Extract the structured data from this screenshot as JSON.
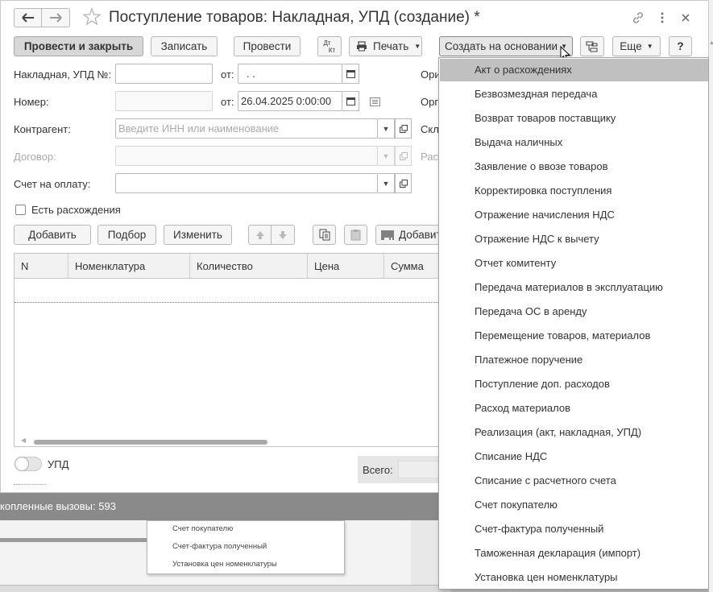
{
  "window": {
    "title": "Поступление товаров: Накладная, УПД (создание) *"
  },
  "toolbar": {
    "post_close": "Провести и закрыть",
    "save": "Записать",
    "post": "Провести",
    "dtkt_top": "Дт",
    "dtkt_bottom": "Кт",
    "print": "Печать",
    "create_based": "Создать на основании",
    "more": "Еще",
    "help": "?"
  },
  "form": {
    "invoice_label": "Накладная, УПД №:",
    "invoice_value": "",
    "from1_label": "от:",
    "date1_value": " .  .",
    "number_label": "Номер:",
    "from2_label": "от:",
    "date2_value": "26.04.2025  0:00:00",
    "counterparty_label": "Контрагент:",
    "counterparty_placeholder": "Введите ИНН или наименование",
    "contract_label": "Договор:",
    "payment_label": "Счет на оплату:",
    "discrepancy_label": "Есть расхождения",
    "right_labels": [
      "Ори",
      "Орг",
      "Скл",
      "Рас"
    ]
  },
  "table_toolbar": {
    "add": "Добавить",
    "pick": "Подбор",
    "change": "Изменить",
    "add_barcode": "Добавит"
  },
  "table": {
    "columns": [
      "N",
      "Номенклатура",
      "Количество",
      "Цена",
      "Сумма"
    ]
  },
  "footer": {
    "upd_label": "УПД",
    "total_label": "Всего:"
  },
  "background": {
    "status_text": "копленные вызовы: 593",
    "list_items": [
      "Счет покупателю",
      "Счет-фактура полученный",
      "Установка цен номенклатуры"
    ]
  },
  "menu": {
    "selected_index": 0,
    "items": [
      "Акт о расхождениях",
      "Безвозмездная передача",
      "Возврат товаров поставщику",
      "Выдача наличных",
      "Заявление о ввозе товаров",
      "Корректировка поступления",
      "Отражение начисления НДС",
      "Отражение НДС к вычету",
      "Отчет комитенту",
      "Передача материалов в эксплуатацию",
      "Передача ОС в аренду",
      "Перемещение товаров, материалов",
      "Платежное поручение",
      "Поступление доп. расходов",
      "Расход материалов",
      "Реализация (акт, накладная, УПД)",
      "Списание НДС",
      "Списание с расчетного счета",
      "Счет покупателю",
      "Счет-фактура полученный",
      "Таможенная декларация (импорт)",
      "Установка цен номенклатуры"
    ]
  },
  "icons": {
    "back": "arrow-left-icon",
    "forward": "arrow-right-icon",
    "favorite": "star-icon",
    "link": "link-icon",
    "menu": "kebab-icon",
    "close": "close-icon",
    "printer": "printer-icon"
  }
}
